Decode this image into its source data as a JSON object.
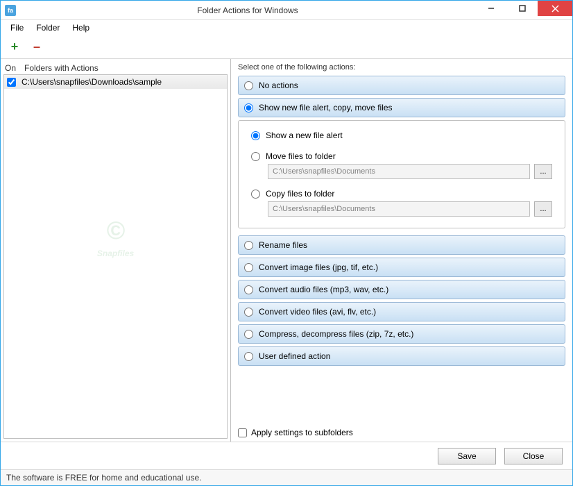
{
  "window": {
    "title": "Folder Actions for Windows",
    "icon_text": "fa"
  },
  "menu": {
    "file": "File",
    "folder": "Folder",
    "help": "Help"
  },
  "toolbar": {
    "add": "+",
    "remove": "–"
  },
  "left": {
    "col_on": "On",
    "col_folders": "Folders with Actions",
    "rows": [
      {
        "checked": true,
        "path": "C:\\Users\\snapfiles\\Downloads\\sample"
      }
    ],
    "watermark": "Snapfiles"
  },
  "right": {
    "heading": "Select one of the following actions:",
    "actions": {
      "none": "No actions",
      "show_alert_group": "Show new file alert, copy, move files",
      "rename": "Rename files",
      "convert_image": "Convert image files (jpg, tif, etc.)",
      "convert_audio": "Convert audio files (mp3, wav, etc.)",
      "convert_video": "Convert video files (avi, flv, etc.)",
      "compress": "Compress, decompress files (zip, 7z, etc.)",
      "user_defined": "User defined action"
    },
    "sub": {
      "show_alert": "Show a new file alert",
      "move_to": "Move files to folder",
      "copy_to": "Copy files to folder",
      "move_path": "C:\\Users\\snapfiles\\Documents",
      "copy_path": "C:\\Users\\snapfiles\\Documents",
      "browse": "..."
    },
    "apply_subfolders": "Apply settings to subfolders"
  },
  "footer": {
    "save": "Save",
    "close": "Close"
  },
  "status": "The software is FREE for home and educational use."
}
